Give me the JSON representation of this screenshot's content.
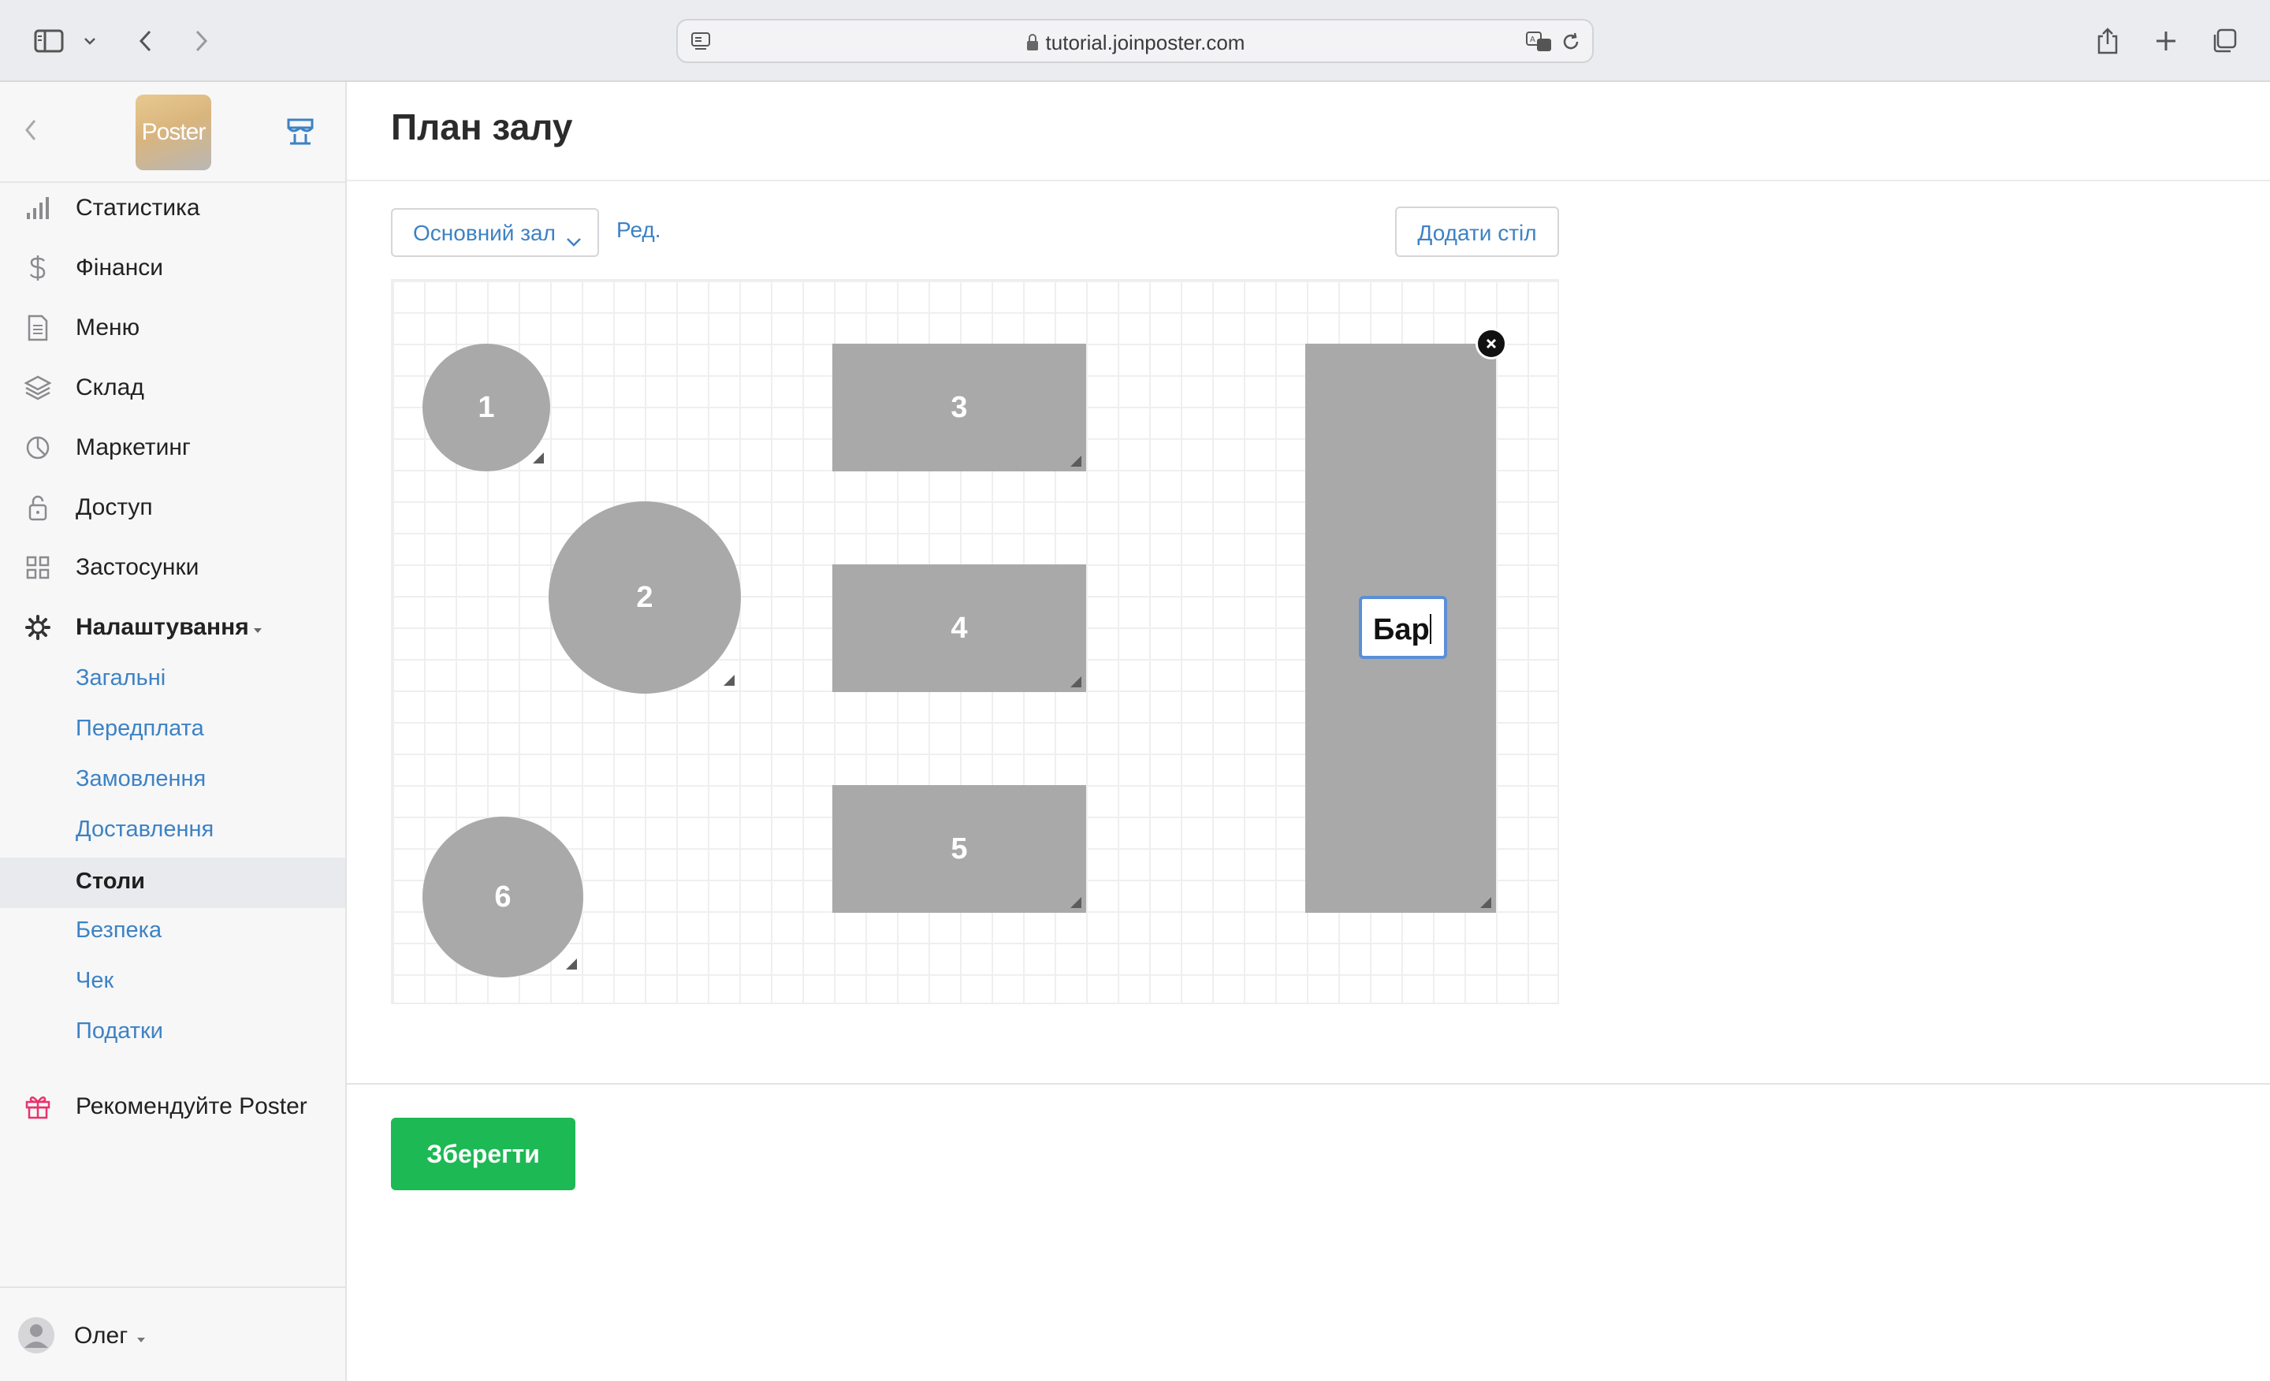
{
  "browser": {
    "url": "tutorial.joinposter.com"
  },
  "sidebar": {
    "logo_text": "Poster",
    "nav": [
      {
        "label": "Статистика",
        "icon": "bar-chart-icon"
      },
      {
        "label": "Фінанси",
        "icon": "dollar-icon"
      },
      {
        "label": "Меню",
        "icon": "document-icon"
      },
      {
        "label": "Склад",
        "icon": "layers-icon"
      },
      {
        "label": "Маркетинг",
        "icon": "pie-icon"
      },
      {
        "label": "Доступ",
        "icon": "lock-icon"
      },
      {
        "label": "Застосунки",
        "icon": "grid-icon"
      },
      {
        "label": "Налаштування",
        "icon": "gear-icon"
      }
    ],
    "settings_sub": [
      {
        "label": "Загальні"
      },
      {
        "label": "Передплата"
      },
      {
        "label": "Замовлення"
      },
      {
        "label": "Доставлення"
      },
      {
        "label": "Столи",
        "active": true
      },
      {
        "label": "Безпека"
      },
      {
        "label": "Чек"
      },
      {
        "label": "Податки"
      }
    ],
    "recommend": "Рекомендуйте Poster",
    "user": "Олег"
  },
  "main": {
    "title": "План залу",
    "hall_select": "Основний зал",
    "edit_link": "Ред.",
    "add_table": "Додати стіл",
    "tables": [
      {
        "label": "1"
      },
      {
        "label": "2"
      },
      {
        "label": "3"
      },
      {
        "label": "4"
      },
      {
        "label": "5"
      },
      {
        "label": "6"
      },
      {
        "label": ""
      }
    ],
    "table_name_input": "Бар",
    "save": "Зберегти"
  }
}
